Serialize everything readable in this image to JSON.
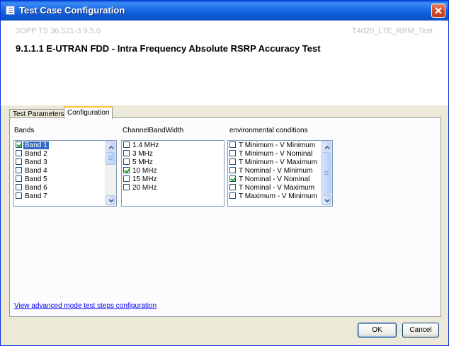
{
  "window": {
    "title": "Test Case Configuration"
  },
  "header": {
    "spec": "3GPP TS 36.521-3 9.5.0",
    "test_id": "T4020_LTE_RRM_Test",
    "test_title": "9.1.1.1 E-UTRAN FDD - Intra Frequency Absolute RSRP Accuracy Test"
  },
  "tabs": [
    {
      "label": "Test Parameters",
      "active": false
    },
    {
      "label": "Configuration",
      "active": true
    }
  ],
  "groups": {
    "bands": {
      "label": "Bands",
      "items": [
        {
          "label": "Band 1",
          "checked": true,
          "selected": true
        },
        {
          "label": "Band 2",
          "checked": false
        },
        {
          "label": "Band 3",
          "checked": false
        },
        {
          "label": "Band 4",
          "checked": false
        },
        {
          "label": "Band 5",
          "checked": false
        },
        {
          "label": "Band 6",
          "checked": false
        },
        {
          "label": "Band 7",
          "checked": false
        }
      ]
    },
    "bandwidth": {
      "label": "ChannelBandWidth",
      "items": [
        {
          "label": "1.4 MHz",
          "checked": false
        },
        {
          "label": "3 MHz",
          "checked": false
        },
        {
          "label": "5 MHz",
          "checked": false
        },
        {
          "label": "10 MHz",
          "checked": true
        },
        {
          "label": "15 MHz",
          "checked": false
        },
        {
          "label": "20 MHz",
          "checked": false
        }
      ]
    },
    "env": {
      "label": "environmental conditions",
      "items": [
        {
          "label": "T Minimum - V Minimum",
          "checked": false
        },
        {
          "label": "T Minimum - V Nominal",
          "checked": false
        },
        {
          "label": "T Minimum - V Maximum",
          "checked": false
        },
        {
          "label": "T Nominal - V Minimum",
          "checked": false
        },
        {
          "label": "T Nominal - V Nominal",
          "checked": true
        },
        {
          "label": "T Nominal - V Maximum",
          "checked": false
        },
        {
          "label": "T Maximum - V Minimum",
          "checked": false
        }
      ]
    }
  },
  "links": {
    "advanced": "View advanced mode test steps configuration"
  },
  "buttons": {
    "ok": "OK",
    "cancel": "Cancel"
  }
}
